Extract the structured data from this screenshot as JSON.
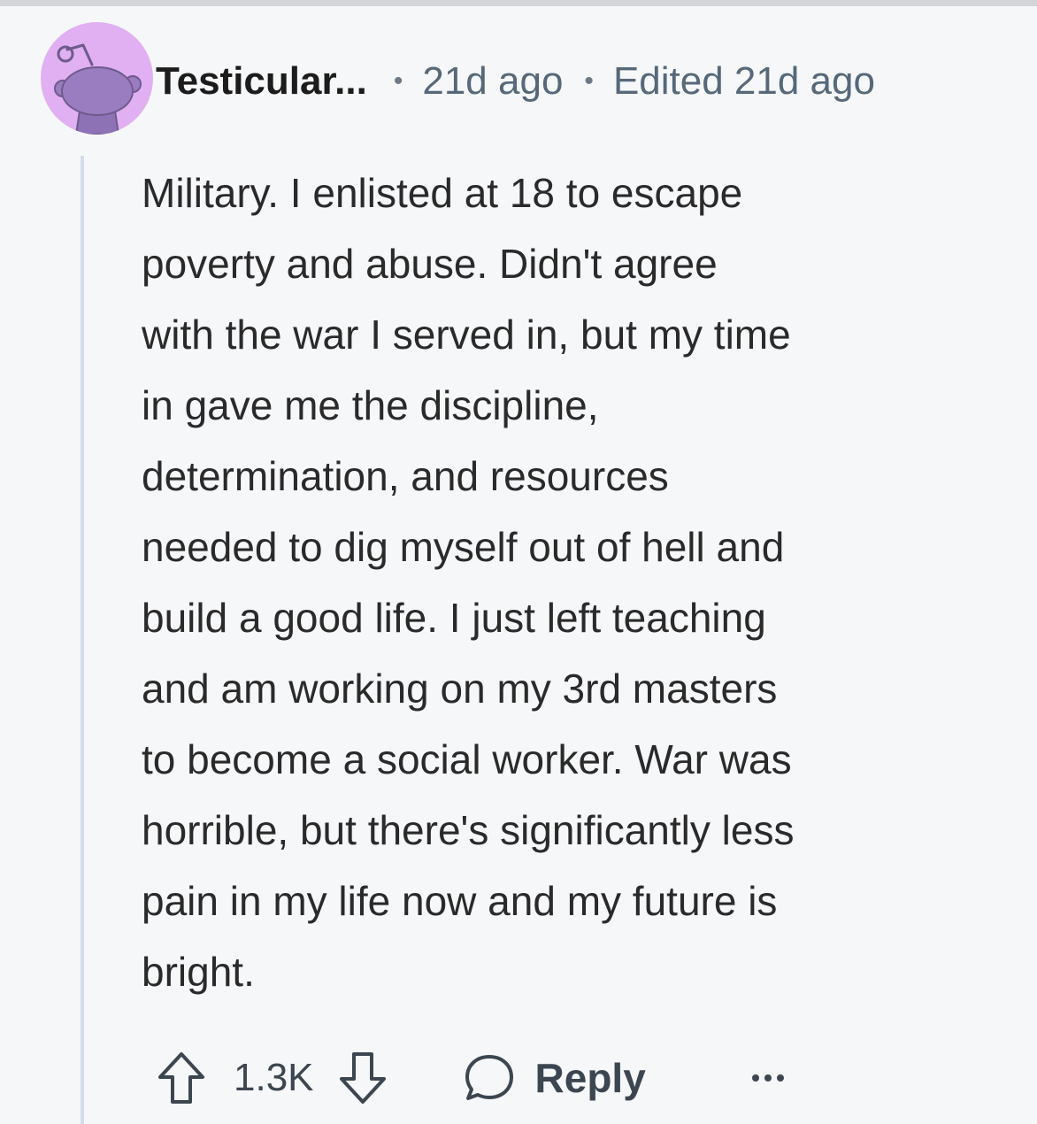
{
  "comment": {
    "author": "Testicular...",
    "posted": "21d ago",
    "edited": "Edited 21d ago",
    "separator": "•",
    "avatar_icon": "reddit-snoo-avatar-icon",
    "body_lines": [
      "Military.  I enlisted at 18 to escape",
      "poverty and abuse.  Didn't agree",
      "with the war I served in, but my time",
      "in gave me the discipline,",
      "determination, and resources",
      "needed to dig myself out of hell and",
      "build a good life.  I just left teaching",
      "and am working on my 3rd masters",
      "to become a social worker.  War was",
      "horrible, but there's significantly less",
      "pain in my life now and my future is",
      "bright."
    ],
    "score": "1.3K",
    "reply_label": "Reply"
  },
  "icons": {
    "upvote": "upvote-arrow-icon",
    "downvote": "downvote-arrow-icon",
    "reply": "speech-bubble-icon",
    "more": "ellipsis-icon"
  },
  "colors": {
    "background": "#f6f7f9",
    "avatar_bg": "#e0b0f2",
    "snoo": "#9a7dc1",
    "thread_line": "#d4dde9",
    "meta_text": "#56687a"
  }
}
